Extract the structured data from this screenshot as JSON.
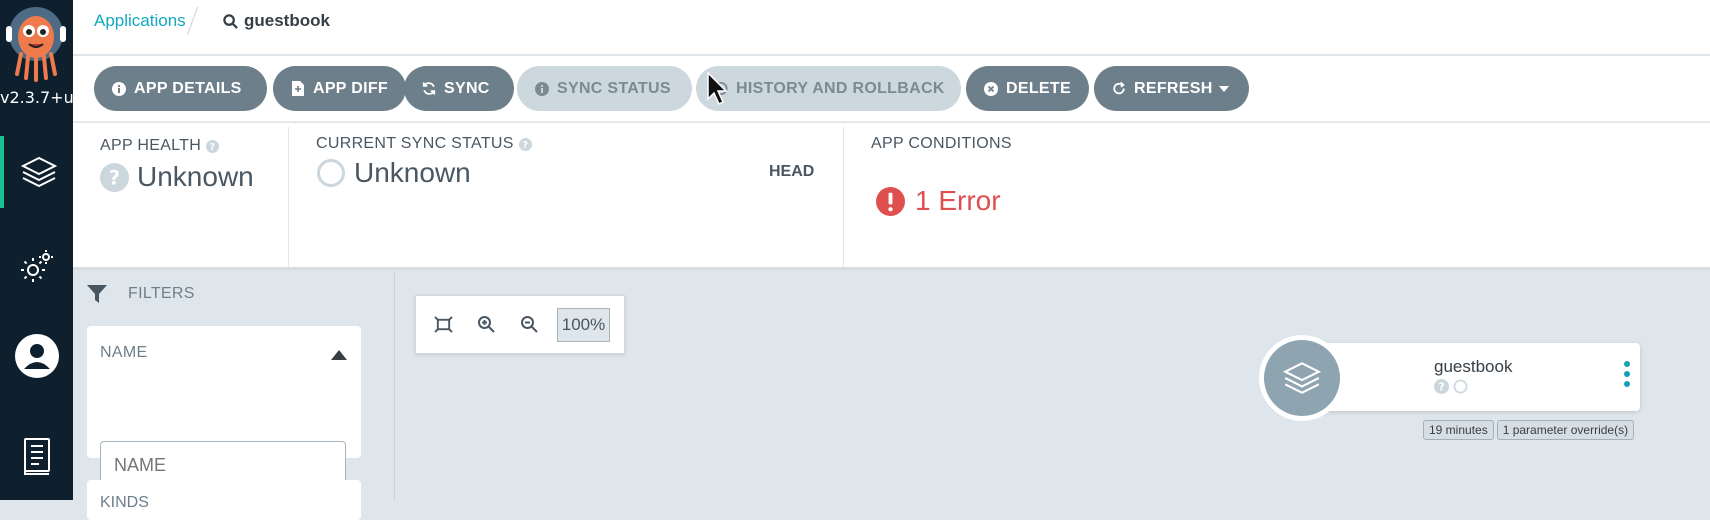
{
  "nav": {
    "version": "v2.3.7+u",
    "items": [
      {
        "icon": "applications-icon",
        "active": true
      },
      {
        "icon": "settings-icon",
        "active": false
      },
      {
        "icon": "user-icon",
        "active": false
      },
      {
        "icon": "docs-icon",
        "active": false
      }
    ]
  },
  "breadcrumb": {
    "parent": "Applications",
    "current": "guestbook"
  },
  "toolbar": {
    "app_details": "APP DETAILS",
    "app_diff": "APP DIFF",
    "sync": "SYNC",
    "sync_status": "SYNC STATUS",
    "history": "HISTORY AND ROLLBACK",
    "delete": "DELETE",
    "refresh": "REFRESH"
  },
  "status": {
    "health_label": "APP HEALTH",
    "health_value": "Unknown",
    "sync_label": "CURRENT SYNC STATUS",
    "sync_value": "Unknown",
    "head_label": "HEAD",
    "conditions_label": "APP CONDITIONS",
    "conditions_value": "1 Error"
  },
  "filters": {
    "title": "FILTERS",
    "name_header": "NAME",
    "name_placeholder": "NAME",
    "kinds_header": "KINDS"
  },
  "zoom": {
    "level": "100%"
  },
  "node": {
    "name": "guestbook",
    "tags": [
      "19 minutes",
      "1 parameter override(s)"
    ]
  },
  "colors": {
    "accent": "#14a8bf",
    "button": "#6d7f8b",
    "error": "#e04f4f",
    "nav_bg": "#0e1f2d"
  }
}
